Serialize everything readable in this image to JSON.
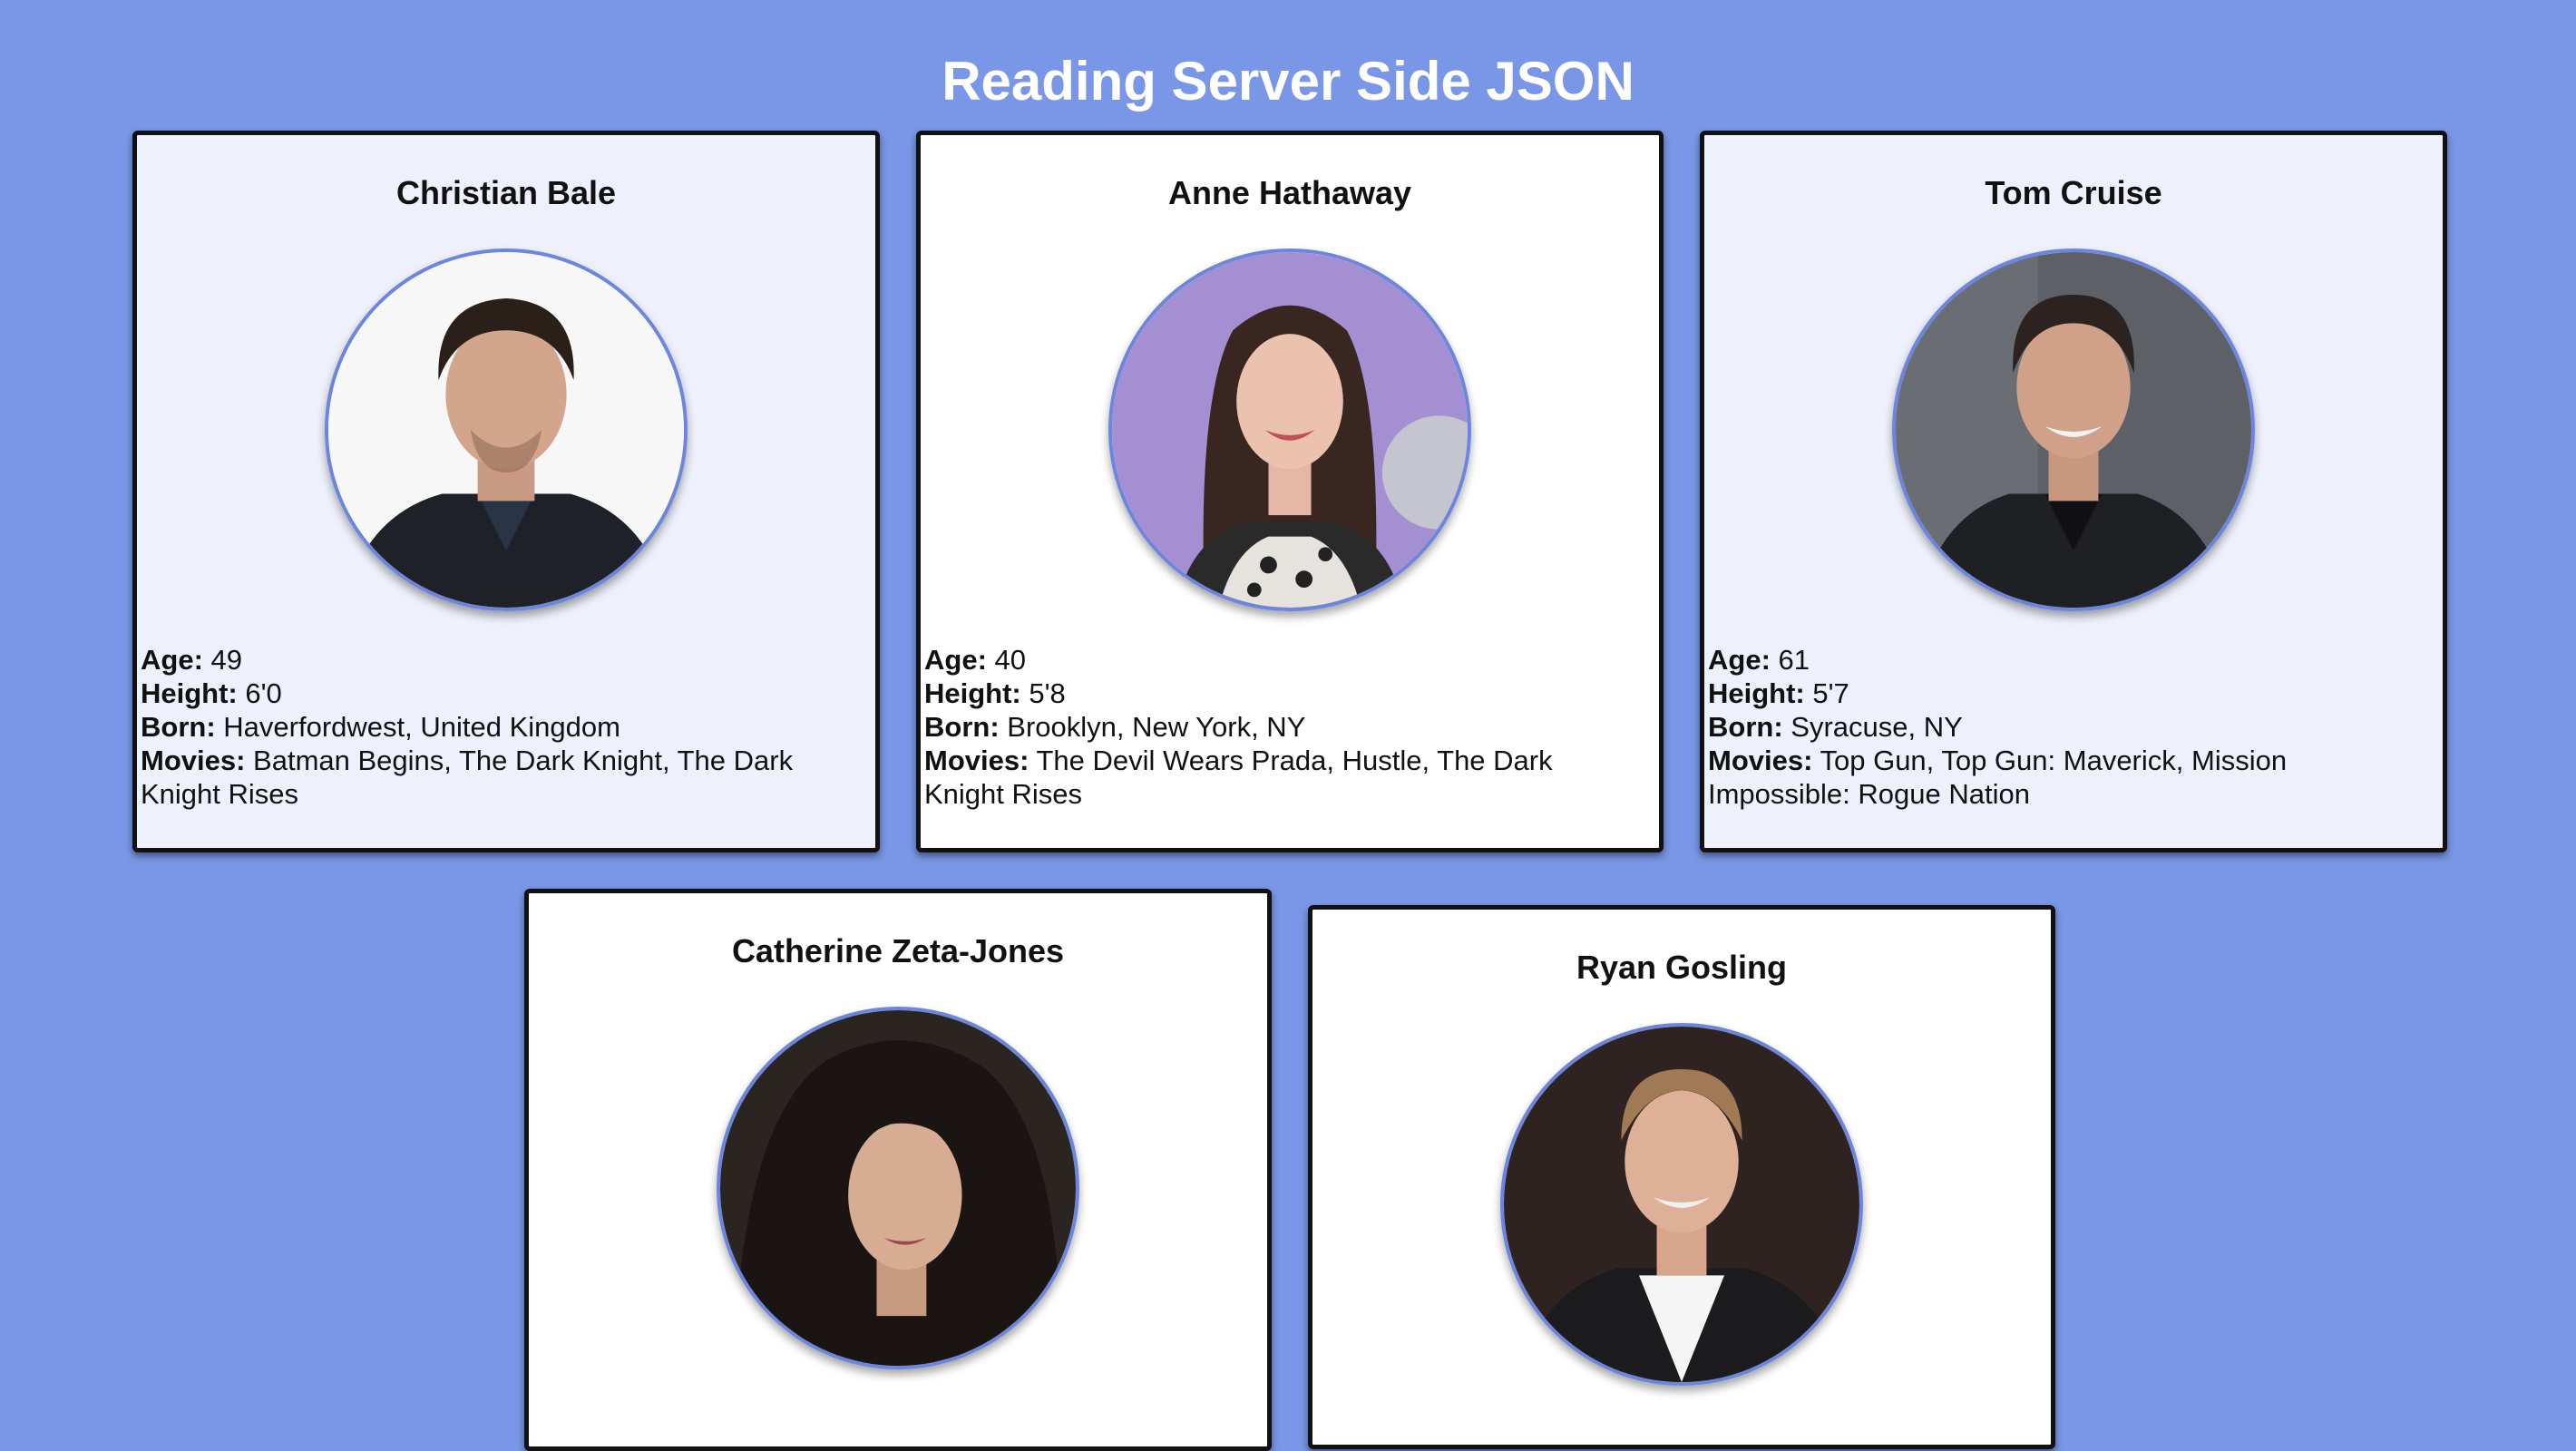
{
  "page": {
    "title": "Reading Server Side JSON"
  },
  "labels": {
    "age": "Age:",
    "height": "Height:",
    "born": "Born:",
    "movies": "Movies:"
  },
  "actors": [
    {
      "name": "Christian Bale",
      "age": "49",
      "height": "6'0",
      "born": "Haverfordwest, United Kingdom",
      "movies": "Batman Begins, The Dark Knight, The Dark Knight Rises"
    },
    {
      "name": "Anne Hathaway",
      "age": "40",
      "height": "5'8",
      "born": "Brooklyn, New York, NY",
      "movies": "The Devil Wears Prada, Hustle, The Dark Knight Rises"
    },
    {
      "name": "Tom Cruise",
      "age": "61",
      "height": "5'7",
      "born": "Syracuse, NY",
      "movies": "Top Gun, Top Gun: Maverick, Mission Impossible: Rogue Nation"
    },
    {
      "name": "Catherine Zeta-Jones"
    },
    {
      "name": "Ryan Gosling"
    }
  ],
  "colors": {
    "page_background": "#7a96e6",
    "card_tint": "#eef1fc",
    "card_border": "#111111",
    "avatar_ring": "#6c86de"
  }
}
